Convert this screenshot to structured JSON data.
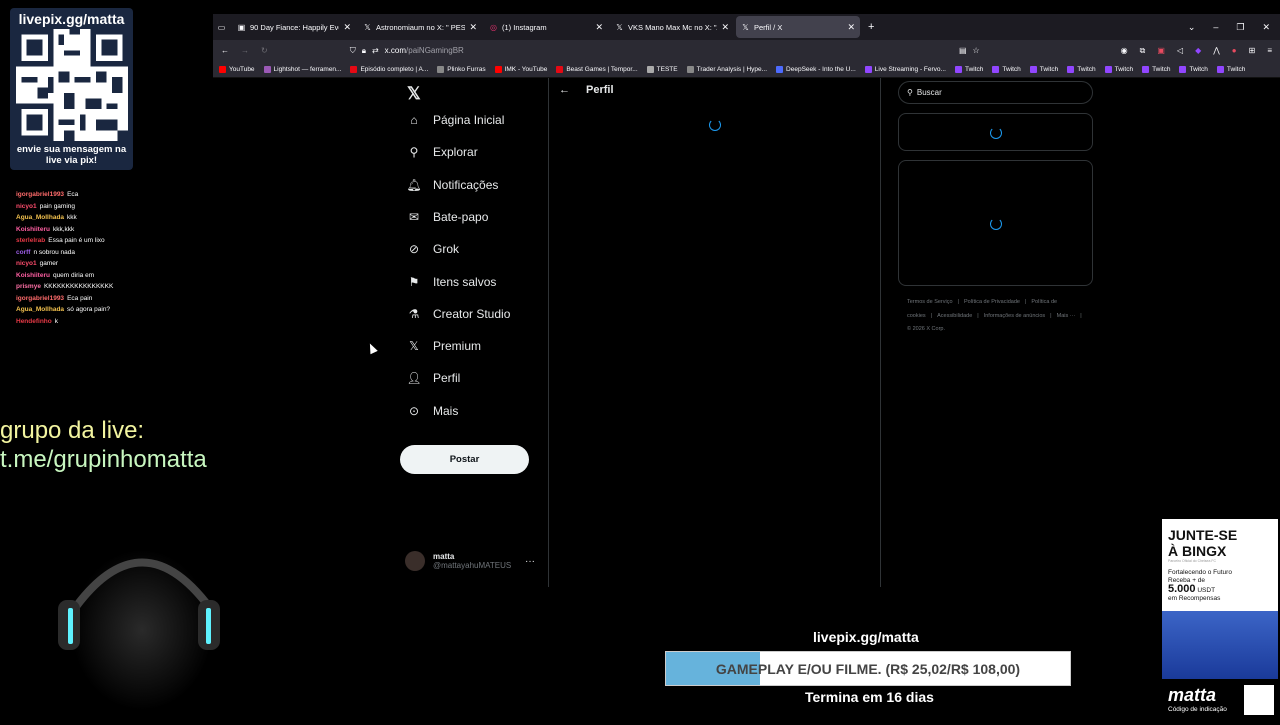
{
  "overlay": {
    "qr_title": "livepix.gg/matta",
    "qr_caption": "envie sua mensagem na live via pix!",
    "grupo_line1": "grupo da live:",
    "grupo_line2": "t.me/grupinhomatta",
    "chat": [
      {
        "user": "igorgabriel1993",
        "color": "#ff6b6b",
        "msg": "Eca"
      },
      {
        "user": "nicyo1",
        "color": "#ff4d6d",
        "msg": "pain gaming"
      },
      {
        "user": "Agua_Mollhada",
        "color": "#f2c14e",
        "msg": "kkk"
      },
      {
        "user": "Koishiiteru",
        "color": "#ff5fa2",
        "msg": "kkk,kkk"
      },
      {
        "user": "sterlelrab",
        "color": "#e63946",
        "msg": "Essa pain é um lixo"
      },
      {
        "user": "corff",
        "color": "#9b5de5",
        "msg": "n sobrou nada"
      },
      {
        "user": "nicyo1",
        "color": "#ff4d6d",
        "msg": "gamer"
      },
      {
        "user": "Koishiiteru",
        "color": "#ff5fa2",
        "msg": "quem diria em"
      },
      {
        "user": "prismye",
        "color": "#ff70a6",
        "msg": "KKKKKKKKKKKKKKKK"
      },
      {
        "user": "igorgabriel1993",
        "color": "#ff6b6b",
        "msg": "Eca pain"
      },
      {
        "user": "Agua_Mollhada",
        "color": "#f2c14e",
        "msg": "só agora pain?"
      },
      {
        "user": "Hendefinho",
        "color": "#e63946",
        "msg": "k"
      }
    ],
    "livepix": "livepix.gg/matta",
    "goal_text": "GAMEPLAY E/OU FILME. (R$ 25,02/R$ 108,00)",
    "goal_progress": 0.232,
    "termina": "Termina em 16 dias"
  },
  "browser": {
    "tabs": [
      {
        "title": "90 Day Fiance: Happily Ever Aft",
        "icon": "tv-icon",
        "active": false
      },
      {
        "title": "Astronomiaum no X: \" PESQU",
        "icon": "x-icon",
        "active": false
      },
      {
        "title": "(1) Instagram",
        "icon": "instagram-icon",
        "active": false
      },
      {
        "title": "VKS Mano Max Mc no X: \"A ma",
        "icon": "x-icon",
        "active": false
      },
      {
        "title": "Perfil / X",
        "icon": "x-icon",
        "active": true
      }
    ],
    "url_host": "x.com",
    "url_path": "/paiNGamingBR",
    "bookmarks": [
      {
        "label": "YouTube",
        "color": "#ff0000"
      },
      {
        "label": "Lightshot — ferramen...",
        "color": "#9b59b6"
      },
      {
        "label": "Episódio completo | A...",
        "color": "#e50914"
      },
      {
        "label": "Plinko Furras",
        "color": "#888888"
      },
      {
        "label": "IMK - YouTube",
        "color": "#ff0000"
      },
      {
        "label": "Beast Games | Tempor...",
        "color": "#e50914"
      },
      {
        "label": "TESTE",
        "color": "#aaaaaa"
      },
      {
        "label": "Trader Analysis | Hype...",
        "color": "#888888"
      },
      {
        "label": "DeepSeek - Into the U...",
        "color": "#4d6bfe"
      },
      {
        "label": "Live Streaming - Fervo...",
        "color": "#9146ff"
      },
      {
        "label": "Twitch",
        "color": "#9146ff"
      },
      {
        "label": "Twitch",
        "color": "#9146ff"
      },
      {
        "label": "Twitch",
        "color": "#9146ff"
      },
      {
        "label": "Twitch",
        "color": "#9146ff"
      },
      {
        "label": "Twitch",
        "color": "#9146ff"
      },
      {
        "label": "Twitch",
        "color": "#9146ff"
      },
      {
        "label": "Twitch",
        "color": "#9146ff"
      },
      {
        "label": "Twitch",
        "color": "#9146ff"
      }
    ]
  },
  "x": {
    "logo": "𝕏",
    "nav": [
      {
        "label": "Página Inicial",
        "icon": "home-icon",
        "glyph": "⌂"
      },
      {
        "label": "Explorar",
        "icon": "search-icon",
        "glyph": "⚲"
      },
      {
        "label": "Notificações",
        "icon": "bell-icon",
        "glyph": "🔔︎"
      },
      {
        "label": "Bate-papo",
        "icon": "mail-icon",
        "glyph": "✉"
      },
      {
        "label": "Grok",
        "icon": "grok-icon",
        "glyph": "⊘"
      },
      {
        "label": "Itens salvos",
        "icon": "bookmark-icon",
        "glyph": "⚑"
      },
      {
        "label": "Creator Studio",
        "icon": "flask-icon",
        "glyph": "⚗"
      },
      {
        "label": "Premium",
        "icon": "x-icon",
        "glyph": "𝕏"
      },
      {
        "label": "Perfil",
        "icon": "person-icon",
        "glyph": "👤︎"
      },
      {
        "label": "Mais",
        "icon": "more-circle-icon",
        "glyph": "⊙"
      }
    ],
    "post_label": "Postar",
    "account_name": "matta",
    "account_handle": "@mattayahuMATEUS",
    "header_title": "Perfil",
    "search_placeholder": "Buscar",
    "footer_links": [
      "Termos de Serviço",
      "Política de Privacidade",
      "Política de cookies",
      "Acessibilidade",
      "Informações de anúncios",
      "Mais ···",
      "© 2026 X Corp."
    ]
  },
  "ad": {
    "title_line1": "JUNTE-SE",
    "title_line2": "À BINGX",
    "subtitle": "Parceiro Oficial do Chelsea FC",
    "text1": "Fortalecendo o Futuro",
    "text2": "Receba + de",
    "amount": "5.000",
    "currency": "USDT",
    "text3": "em Recompensas",
    "brand": "matta",
    "code_label": "Código de indicação"
  }
}
